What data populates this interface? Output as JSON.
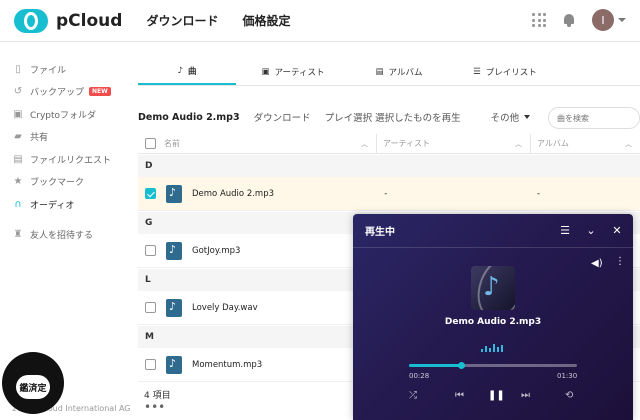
{
  "app": {
    "brand": "pCloud"
  },
  "topnav": [
    "ダウンロード",
    "価格設定"
  ],
  "user": {
    "initial": "I"
  },
  "sidebar": {
    "items": [
      {
        "label": "ファイル",
        "icon": "file-icon"
      },
      {
        "label": "バックアップ",
        "icon": "history-icon",
        "badge": "NEW"
      },
      {
        "label": "Cryptoフォルダ",
        "icon": "lock-icon"
      },
      {
        "label": "共有",
        "icon": "share-icon"
      },
      {
        "label": "ファイルリクエスト",
        "icon": "file-request-icon"
      },
      {
        "label": "ブックマーク",
        "icon": "star-icon"
      },
      {
        "label": "オーディオ",
        "icon": "headphones-icon",
        "active": true
      }
    ],
    "invite": {
      "label": "友人を招待する",
      "icon": "trophy-icon"
    },
    "footer": "2024 pCloud International AG",
    "seal_text": "鑑済定"
  },
  "tabs": [
    {
      "label": "曲",
      "icon": "note-icon",
      "active": true
    },
    {
      "label": "アーティスト",
      "icon": "artist-icon"
    },
    {
      "label": "アルバム",
      "icon": "album-icon"
    },
    {
      "label": "プレイリスト",
      "icon": "playlist-icon"
    }
  ],
  "actionbar": {
    "selected_file": "Demo Audio 2.mp3",
    "download": "ダウンロード",
    "play_selected": "プレイ選択 選択したものを再生",
    "other": "その他"
  },
  "search": {
    "placeholder": "曲を検索"
  },
  "table": {
    "columns": {
      "name": "名前",
      "artist": "アーティスト",
      "album": "アルバム"
    },
    "groups": [
      {
        "letter": "D",
        "rows": [
          {
            "name": "Demo Audio 2.mp3",
            "artist": "-",
            "album": "-",
            "selected": true
          }
        ]
      },
      {
        "letter": "G",
        "rows": [
          {
            "name": "GotJoy.mp3",
            "artist": "",
            "album": ""
          }
        ]
      },
      {
        "letter": "L",
        "rows": [
          {
            "name": "Lovely Day.wav",
            "artist": "",
            "album": ""
          }
        ]
      },
      {
        "letter": "M",
        "rows": [
          {
            "name": "Momentum.mp3",
            "artist": "",
            "album": ""
          }
        ]
      }
    ],
    "count": "4 項目"
  },
  "player": {
    "title": "再生中",
    "track": "Demo Audio 2.mp3",
    "current_time": "00:28",
    "total_time": "01:30",
    "progress": 0.31
  },
  "colors": {
    "accent": "#17bed0",
    "player_bg": "#251a4f",
    "selected_row": "#fff8e8",
    "badge": "#f24d4d"
  }
}
